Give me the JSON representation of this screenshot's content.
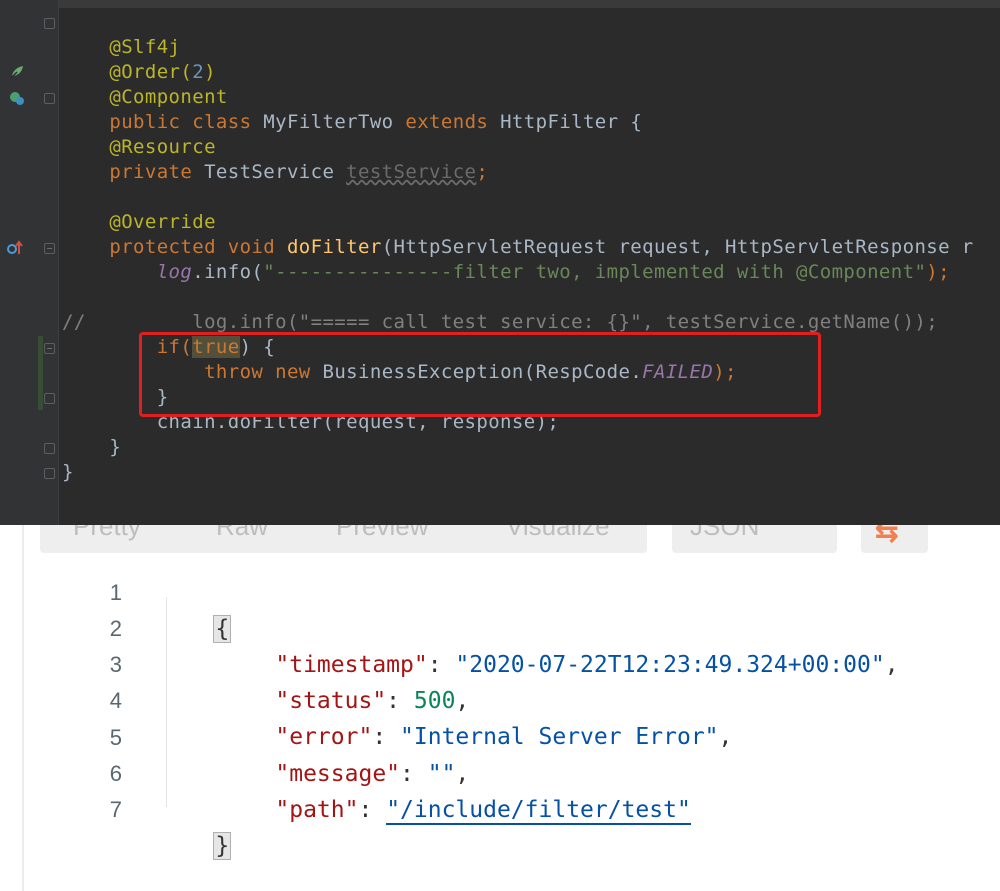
{
  "ide": {
    "code_lines": {
      "l1": "@Slf4j",
      "l2_ann": "@Order(",
      "l2_num": "2",
      "l2_close": ")",
      "l3": "@Component",
      "l4_kw1": "public",
      "l4_kw2": "class",
      "l4_name": "MyFilterTwo",
      "l4_kw3": "extends",
      "l4_super": "HttpFilter {",
      "l6_ann": "@Resource",
      "l7_kw": "private",
      "l7_type": "TestService",
      "l7_field": "testService",
      "l7_semi": ";",
      "l9_ann": "@Override",
      "l10_kw1": "protected",
      "l10_kw2": "void",
      "l10_fn": "doFilter",
      "l10_params": "(HttpServletRequest request, HttpServletResponse r",
      "l11_log": "log",
      "l11_call": ".info(",
      "l11_str": "\"---------------filter two, implemented with @Component\"",
      "l11_end": ");",
      "l13_comment": "//         log.info(\"===== call test service: {}\", testService.getName());",
      "l14_if": "if(",
      "l14_true": "true",
      "l14_rest": ") {",
      "l15_throw": "throw",
      "l15_new": "new",
      "l15_exc": "BusinessException(RespCode.",
      "l15_const": "FAILED",
      "l15_end": ");",
      "l16": "}",
      "l17": "chain.doFilter(request, response);",
      "l18": "}",
      "l19": "}"
    }
  },
  "viewer": {
    "tabs": [
      "Pretty",
      "Raw",
      "Preview",
      "Visualize"
    ],
    "format_label": "JSON",
    "wrap_icon": "wrap-lines-icon",
    "line_numbers": [
      "1",
      "2",
      "3",
      "4",
      "5",
      "6",
      "7"
    ],
    "json": {
      "open_brace": "{",
      "close_brace": "}",
      "timestamp_key": "\"timestamp\"",
      "timestamp_val": "\"2020-07-22T12:23:49.324+00:00\"",
      "status_key": "\"status\"",
      "status_val": "500",
      "error_key": "\"error\"",
      "error_val": "\"Internal Server Error\"",
      "message_key": "\"message\"",
      "message_val": "\"\"",
      "path_key": "\"path\"",
      "path_val": "\"/include/filter/test\""
    }
  },
  "colors": {
    "ide_bg": "#2b2b2b",
    "keyword": "#cc7832",
    "annotation": "#bbb529",
    "string": "#6a8759",
    "highlight_box": "#e02020",
    "json_key": "#a31515",
    "json_string": "#0451a5",
    "json_number": "#098658"
  }
}
